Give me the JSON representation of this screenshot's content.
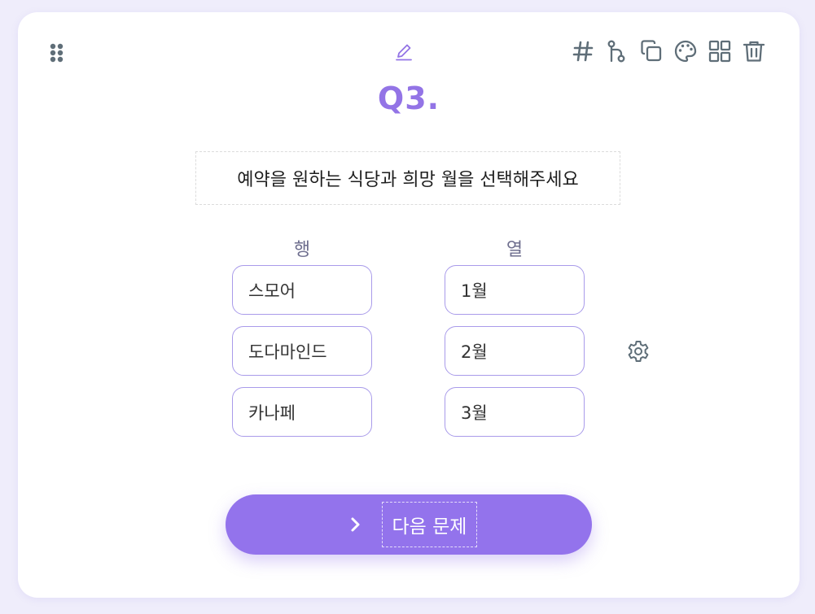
{
  "question": {
    "number": "Q3.",
    "text": "예약을 원하는 식당과 희망 월을 선택해주세요"
  },
  "toolbar": {
    "icons": [
      "hash-icon",
      "branch-icon",
      "copy-icon",
      "palette-icon",
      "grid-icon",
      "trash-icon"
    ]
  },
  "matrix": {
    "row_header": "행",
    "col_header": "열",
    "rows": [
      "스모어",
      "도다마인드",
      "카나페"
    ],
    "cols": [
      "1월",
      "2월",
      "3월"
    ]
  },
  "next_button": {
    "label": "다음 문제"
  },
  "colors": {
    "accent": "#9374e6",
    "button": "#9373ec",
    "icon": "#5f6e78",
    "option_border": "#a99bea",
    "background": "#efedfb"
  }
}
